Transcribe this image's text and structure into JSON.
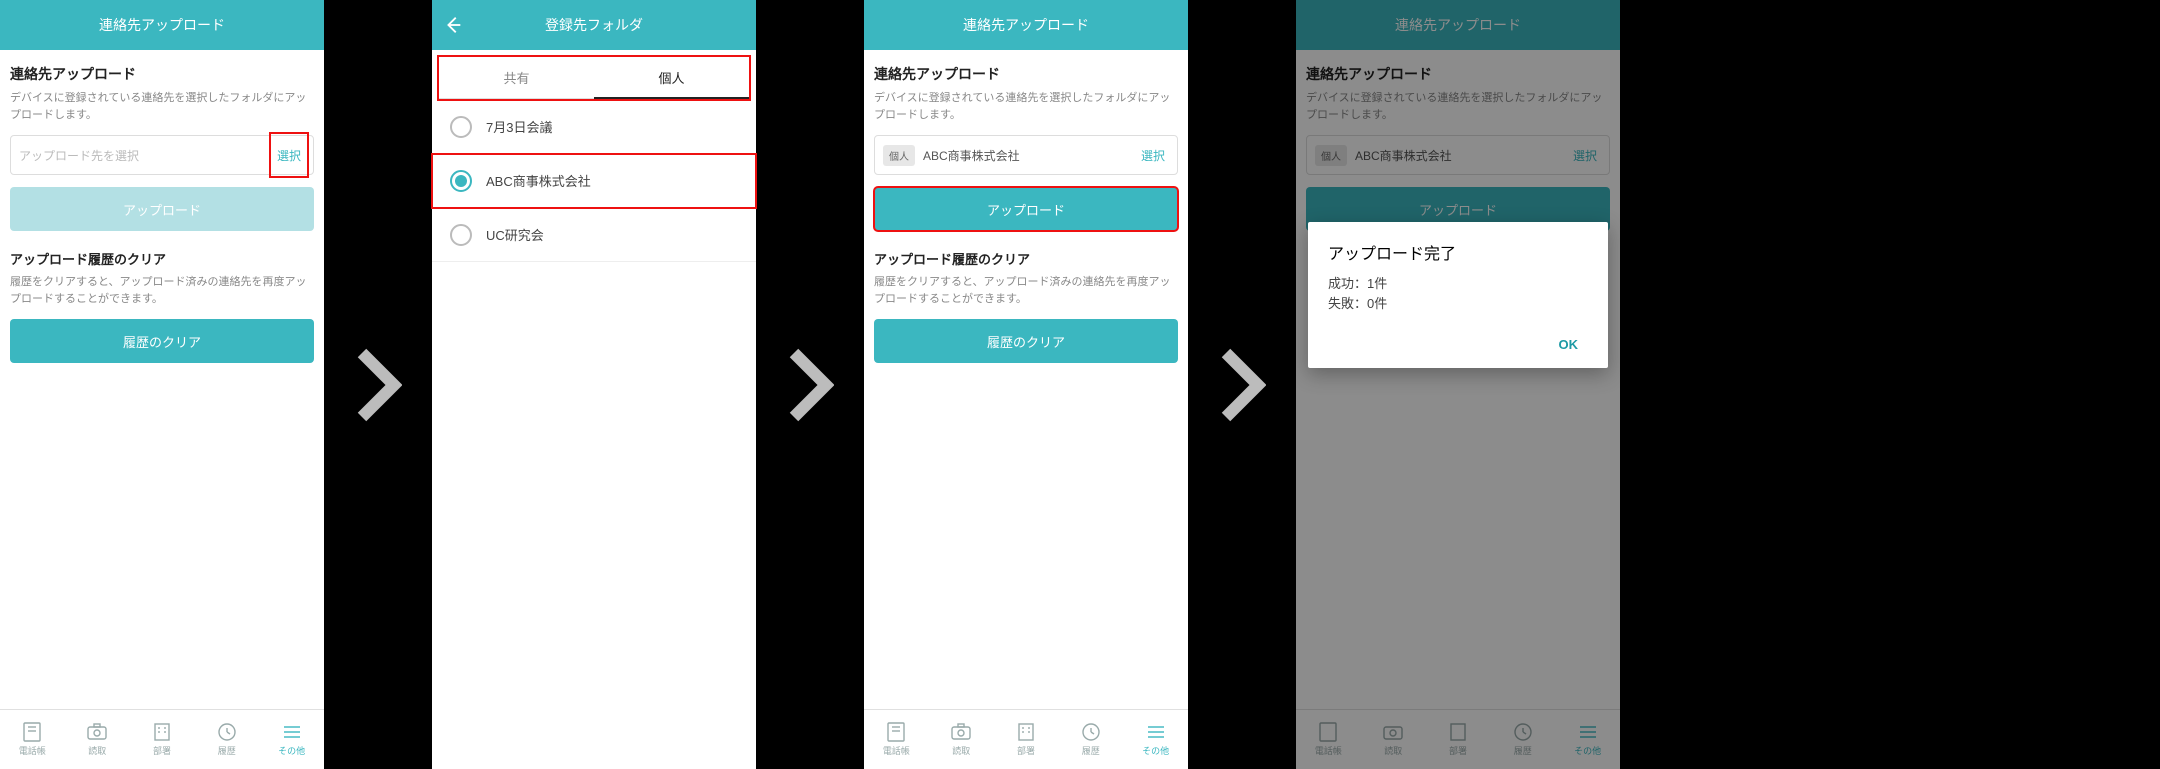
{
  "arrow_glyph": "›",
  "screen1": {
    "header_title": "連絡先アップロード",
    "section_title": "連絡先アップロード",
    "section_desc": "デバイスに登録されている連絡先を選択したフォルダにアップロードします。",
    "select_placeholder": "アップロード先を選択",
    "select_action": "選択",
    "upload_btn": "アップロード",
    "clear_title": "アップロード履歴のクリア",
    "clear_desc": "履歴をクリアすると、アップロード済みの連絡先を再度アップロードすることができます。",
    "clear_btn": "履歴のクリア"
  },
  "screen2": {
    "header_title": "登録先フォルダ",
    "tab_shared": "共有",
    "tab_personal": "個人",
    "folders": [
      {
        "label": "7月3日会議",
        "selected": false
      },
      {
        "label": "ABC商事株式会社",
        "selected": true
      },
      {
        "label": "UC研究会",
        "selected": false
      }
    ]
  },
  "screen3": {
    "header_title": "連絡先アップロード",
    "section_title": "連絡先アップロード",
    "section_desc": "デバイスに登録されている連絡先を選択したフォルダにアップロードします。",
    "select_badge": "個人",
    "select_value": "ABC商事株式会社",
    "select_action": "選択",
    "upload_btn": "アップロード",
    "clear_title": "アップロード履歴のクリア",
    "clear_desc": "履歴をクリアすると、アップロード済みの連絡先を再度アップロードすることができます。",
    "clear_btn": "履歴のクリア"
  },
  "screen4": {
    "header_title": "連絡先アップロード",
    "section_title": "連絡先アップロード",
    "section_desc": "デバイスに登録されている連絡先を選択したフォルダにアップロードします。",
    "select_badge": "個人",
    "select_value": "ABC商事株式会社",
    "select_action": "選択",
    "upload_btn": "アップロード",
    "status_line": "成功：1件 失敗：0件",
    "dialog": {
      "title": "アップロード完了",
      "line1": "成功：1件",
      "line2": "失敗：0件",
      "ok": "OK"
    }
  },
  "nav": {
    "items": [
      {
        "label": "電話帳"
      },
      {
        "label": "読取"
      },
      {
        "label": "部署"
      },
      {
        "label": "履歴"
      },
      {
        "label": "その他"
      }
    ]
  }
}
